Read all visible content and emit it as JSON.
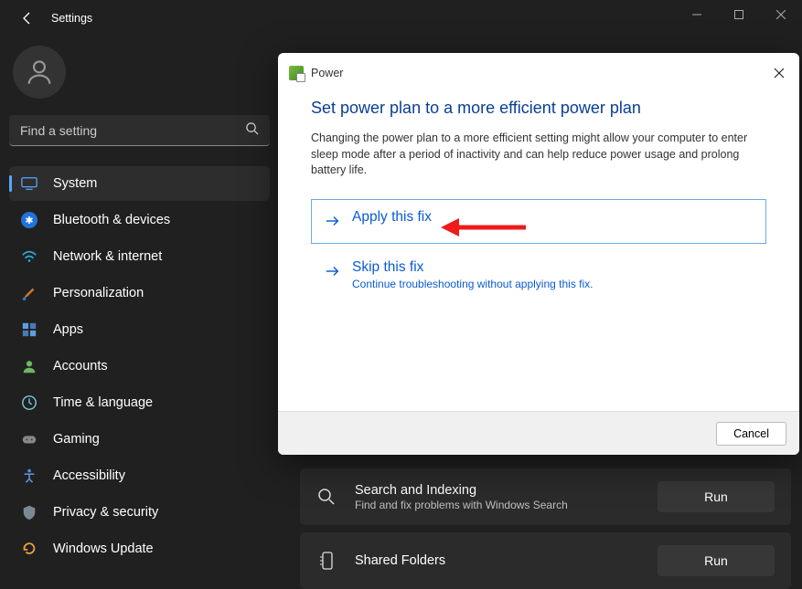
{
  "titlebar": {
    "app_title": "Settings"
  },
  "search": {
    "placeholder": "Find a setting"
  },
  "sidebar": {
    "items": [
      {
        "label": "System"
      },
      {
        "label": "Bluetooth & devices"
      },
      {
        "label": "Network & internet"
      },
      {
        "label": "Personalization"
      },
      {
        "label": "Apps"
      },
      {
        "label": "Accounts"
      },
      {
        "label": "Time & language"
      },
      {
        "label": "Gaming"
      },
      {
        "label": "Accessibility"
      },
      {
        "label": "Privacy & security"
      },
      {
        "label": "Windows Update"
      }
    ]
  },
  "troubleshoot": {
    "rows": [
      {
        "title": "Search and Indexing",
        "sub": "Find and fix problems with Windows Search",
        "action": "Run"
      },
      {
        "title": "Shared Folders",
        "sub": "",
        "action": "Run"
      }
    ]
  },
  "dialog": {
    "category": "Power",
    "heading": "Set power plan to a more efficient power plan",
    "description": "Changing the power plan to a more efficient setting might allow your computer to enter sleep mode after a period of inactivity and can help reduce power usage and prolong battery life.",
    "apply_label": "Apply this fix",
    "skip_label": "Skip this fix",
    "skip_sub": "Continue troubleshooting without applying this fix.",
    "cancel_label": "Cancel"
  }
}
